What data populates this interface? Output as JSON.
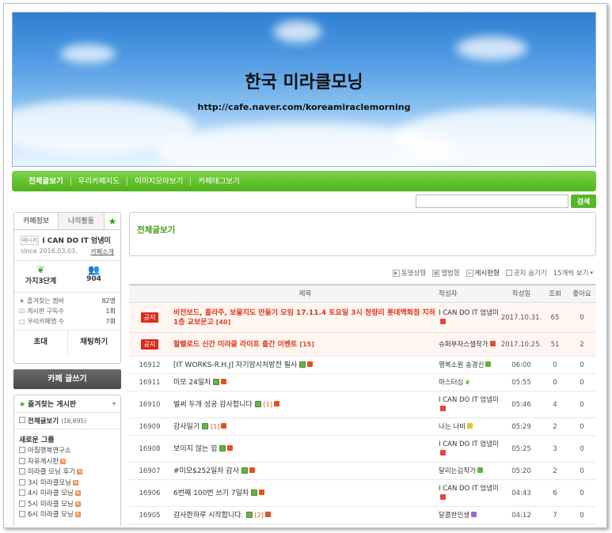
{
  "banner": {
    "title": "한국 미라클모닝",
    "url": "http://cafe.naver.com/koreamiraclemorning"
  },
  "menu": {
    "items": [
      "전체글보기",
      "우리카페지도",
      "이미지모아보기",
      "카페태그보기"
    ]
  },
  "search": {
    "placeholder": "",
    "button_label": "검색"
  },
  "sidebar": {
    "tabs": [
      "카페정보",
      "나의활동"
    ],
    "cafe": {
      "level_badge": "매니저",
      "name": "I CAN DO IT 엄냄미",
      "since": "since 2016.03.03.",
      "intro_link": "카페소개",
      "rank": "가지3단계",
      "members": "904"
    },
    "info": [
      {
        "label": "즐겨찾는 멤버",
        "value": "82명",
        "icon": "star-icon"
      },
      {
        "label": "게시판 구독수",
        "value": "1회",
        "icon": "check-icon"
      },
      {
        "label": "우리카페앱 수",
        "value": "7회",
        "icon": "app-icon"
      }
    ],
    "actions": [
      "초대",
      "채팅하기"
    ],
    "write_button": "카페 글쓰기",
    "favorites": {
      "title": "즐겨찾는 게시판",
      "all_board_label": "전체글보기",
      "all_board_count": "(16,695)",
      "group_title": "새로운 그룹",
      "boards": [
        {
          "label": "아침행복연구소",
          "new": false
        },
        {
          "label": "자유게시판",
          "new": true
        },
        {
          "label": "미라클 모닝 후기",
          "new": true
        },
        {
          "label": "3시 미라클모닝",
          "new": true
        },
        {
          "label": "4시 미라클 모닝",
          "new": true
        },
        {
          "label": "5시 미라클 모닝",
          "new": true
        },
        {
          "label": "6시 미라클 모닝",
          "new": true
        }
      ]
    }
  },
  "main": {
    "title": "전체글보기",
    "toolbar": {
      "album": "동영상형",
      "list_album": "앨범형",
      "board_type": "게시판형",
      "hide_notice": "공지 숨기기",
      "per_page": "15개씩 보기"
    },
    "columns": [
      "제목",
      "작성자",
      "작성일",
      "조회",
      "좋아요"
    ],
    "notice_label": "공지",
    "rows": [
      {
        "id": "",
        "notice": true,
        "title": "비전보드, 콜라주, 보물지도 만들기 모임 17.11.4 토요일 3시 청량리 롯데백화점 지하1층 교보문고",
        "comments": "[40]",
        "author": "I CAN DO IT 엄냄미",
        "author_badge": "red",
        "date": "2017.10.31.",
        "views": "65",
        "likes": "0"
      },
      {
        "id": "",
        "notice": true,
        "title": "할렐로드 신간 미라클 라이프 출간 이벤트",
        "comments": "[15]",
        "author": "슈퍼부자스셀작가",
        "author_badge": "red",
        "date": "2017.10.25.",
        "views": "51",
        "likes": "2"
      },
      {
        "id": "16912",
        "notice": false,
        "title": "[IT WORKS-R.H.J] 자기암시처방전 필사",
        "comments": "",
        "author": "행복소원 송경신",
        "author_badge": "green",
        "date": "06:00",
        "views": "0",
        "likes": "0"
      },
      {
        "id": "16911",
        "notice": false,
        "title": "미모 24일차",
        "comments": "",
        "author": "마스터심",
        "author_badge": "sprout",
        "date": "05:55",
        "views": "0",
        "likes": "0"
      },
      {
        "id": "16910",
        "notice": false,
        "title": "벌써 두개 성공 감사합니다",
        "comments": "[1]",
        "author": "I CAN DO IT 엄냄미",
        "author_badge": "red",
        "date": "05:46",
        "views": "4",
        "likes": "0"
      },
      {
        "id": "16909",
        "notice": false,
        "title": "감사일기",
        "comments": "[1]",
        "author": "나는 나비",
        "author_badge": "yellow",
        "date": "05:29",
        "views": "2",
        "likes": "0"
      },
      {
        "id": "16908",
        "notice": false,
        "title": "보이지 않는 힘",
        "comments": "",
        "author": "I CAN DO IT 엄냄미",
        "author_badge": "red",
        "date": "05:25",
        "views": "3",
        "likes": "0"
      },
      {
        "id": "16907",
        "notice": false,
        "title": "#미모$252일차 감사",
        "comments": "",
        "author": "달리는김작가",
        "author_badge": "green",
        "date": "05:20",
        "views": "2",
        "likes": "0"
      },
      {
        "id": "16906",
        "notice": false,
        "title": "6번째 100번 쓰기 7일차",
        "comments": "",
        "author": "I CAN DO IT 엄냄미",
        "author_badge": "red",
        "date": "04:43",
        "views": "6",
        "likes": "0"
      },
      {
        "id": "16905",
        "notice": false,
        "title": "감사한하루 시작합니다.",
        "comments": "[2]",
        "author": "달콤한인생",
        "author_badge": "purple",
        "date": "04:12",
        "views": "7",
        "likes": "0"
      }
    ]
  }
}
